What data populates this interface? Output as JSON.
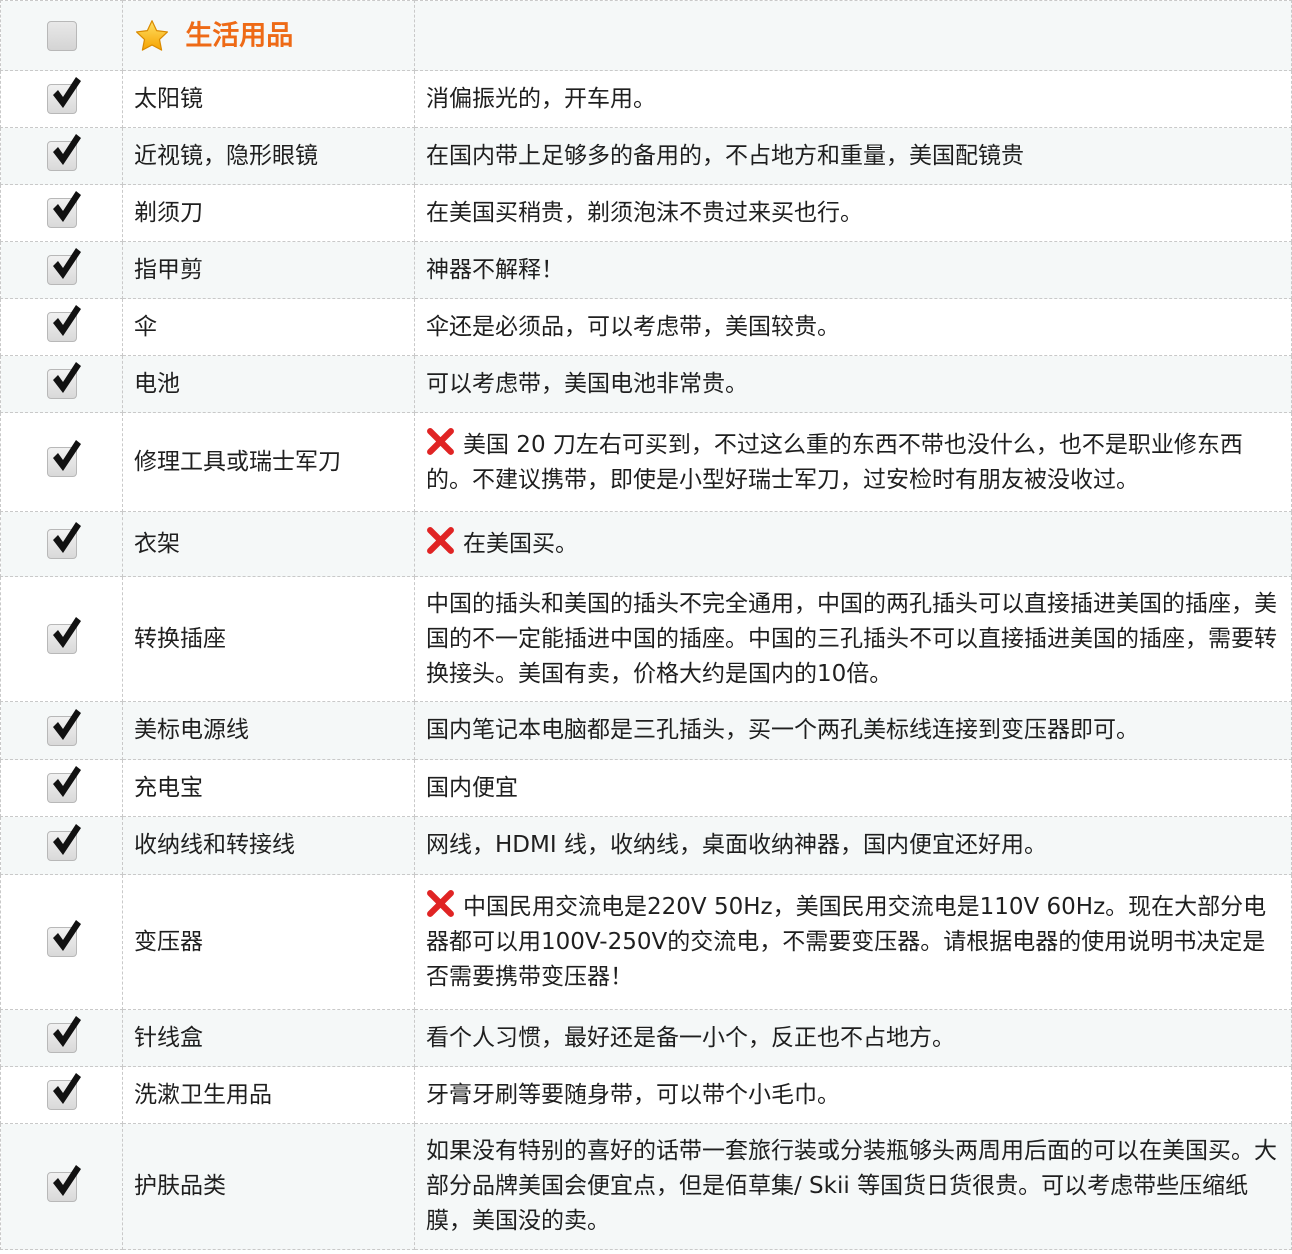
{
  "section": {
    "icon": "star-icon",
    "title": "生活用品"
  },
  "colors": {
    "title": "#ee6a16",
    "xmark": "#e02424",
    "row_alt": "#f5f8f8"
  },
  "rows": [
    {
      "checked": true,
      "item": "太阳镜",
      "x_icon": false,
      "note": "消偏振光的，开车用。"
    },
    {
      "checked": true,
      "item": "近视镜，隐形眼镜",
      "x_icon": false,
      "note": "在国内带上足够多的备用的，不占地方和重量，美国配镜贵"
    },
    {
      "checked": true,
      "item": "剃须刀",
      "x_icon": false,
      "note": "在美国买稍贵，剃须泡沫不贵过来买也行。"
    },
    {
      "checked": true,
      "item": "指甲剪",
      "x_icon": false,
      "note": "神器不解释！"
    },
    {
      "checked": true,
      "item": "伞",
      "x_icon": false,
      "note": "伞还是必须品，可以考虑带，美国较贵。"
    },
    {
      "checked": true,
      "item": "电池",
      "x_icon": false,
      "note": "可以考虑带，美国电池非常贵。"
    },
    {
      "checked": true,
      "item": "修理工具或瑞士军刀",
      "x_icon": true,
      "note": "美国 20 刀左右可买到，不过这么重的东西不带也没什么，也不是职业修东西的。不建议携带，即使是小型好瑞士军刀，过安检时有朋友被没收过。"
    },
    {
      "checked": true,
      "item": "衣架",
      "x_icon": true,
      "note": "在美国买。"
    },
    {
      "checked": true,
      "item": "转换插座",
      "x_icon": false,
      "note": "中国的插头和美国的插头不完全通用，中国的两孔插头可以直接插进美国的插座，美国的不一定能插进中国的插座。中国的三孔插头不可以直接插进美国的插座，需要转换接头。美国有卖，价格大约是国内的10倍。"
    },
    {
      "checked": true,
      "item": "美标电源线",
      "x_icon": false,
      "note": "国内笔记本电脑都是三孔插头，买一个两孔美标线连接到变压器即可。"
    },
    {
      "checked": true,
      "item": "充电宝",
      "x_icon": false,
      "note": "国内便宜"
    },
    {
      "checked": true,
      "item": "收纳线和转接线",
      "x_icon": false,
      "note": "网线，HDMI 线，收纳线，桌面收纳神器，国内便宜还好用。"
    },
    {
      "checked": true,
      "item": "变压器",
      "x_icon": true,
      "note": "中国民用交流电是220V 50Hz，美国民用交流电是110V 60Hz。现在大部分电器都可以用100V-250V的交流电，不需要变压器。请根据电器的使用说明书决定是否需要携带变压器！"
    },
    {
      "checked": true,
      "item": "针线盒",
      "x_icon": false,
      "note": "看个人习惯，最好还是备一小个，反正也不占地方。"
    },
    {
      "checked": true,
      "item": "洗漱卫生用品",
      "x_icon": false,
      "note": "牙膏牙刷等要随身带，可以带个小毛巾。"
    },
    {
      "checked": true,
      "item": "护肤品类",
      "x_icon": false,
      "note": "如果没有特别的喜好的话带一套旅行装或分装瓶够头两周用后面的可以在美国买。大部分品牌美国会便宜点，但是佰草集/ Skii 等国货日货很贵。可以考虑带些压缩纸膜，美国没的卖。"
    }
  ]
}
